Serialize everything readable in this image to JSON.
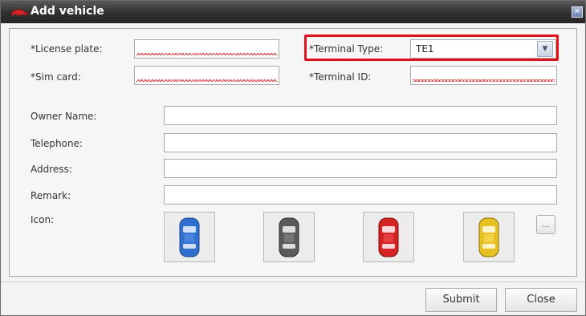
{
  "window": {
    "title": "Add vehicle",
    "title_icon": "red-car-icon",
    "close_glyph": "✕"
  },
  "form": {
    "license_plate": {
      "label": "*License plate:",
      "value": ""
    },
    "sim_card": {
      "label": "*Sim card:",
      "value": ""
    },
    "terminal_type": {
      "label": "*Terminal Type:",
      "value": "TE1",
      "options_visible": [
        "TE1"
      ]
    },
    "terminal_id": {
      "label": "*Terminal ID:",
      "value": ""
    },
    "owner_name": {
      "label": "Owner Name:",
      "value": ""
    },
    "telephone": {
      "label": "Telephone:",
      "value": ""
    },
    "address": {
      "label": "Address:",
      "value": ""
    },
    "remark": {
      "label": "Remark:",
      "value": ""
    },
    "icon": {
      "label": "Icon:",
      "options": [
        {
          "name": "blue-car-icon",
          "color": "#2f6fd0"
        },
        {
          "name": "gray-car-icon",
          "color": "#5a5a5a"
        },
        {
          "name": "red-car-icon",
          "color": "#d52222"
        },
        {
          "name": "yellow-car-icon",
          "color": "#e7c021"
        }
      ],
      "browse_label": "..."
    }
  },
  "buttons": {
    "submit": "Submit",
    "close": "Close"
  },
  "colors": {
    "highlight": "#e0131d",
    "titlebar": "#2f2f2f"
  }
}
